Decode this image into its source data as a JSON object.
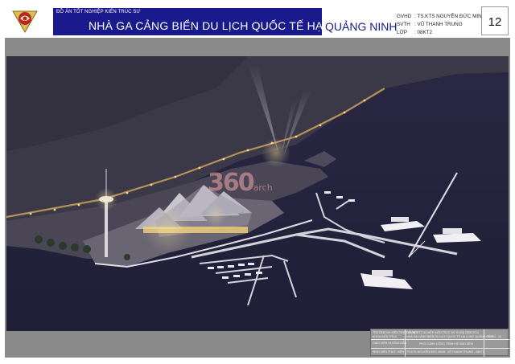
{
  "header": {
    "school_label": "ĐỒ ÁN TỐT NGHIỆP KIẾN TRÚC SƯ",
    "title": "NHÀ GA CẢNG BIỂN DU LỊCH QUỐC TẾ  HẠ LONG",
    "title_suffix": "QUẢNG NINH",
    "info": [
      {
        "key": "GVHD",
        "value": ": TS.KTS NGUYỄN ĐỨC MINH"
      },
      {
        "key": "SVTH",
        "value": ": VŨ THANH TRUNG"
      },
      {
        "key": "LỚP",
        "value": ": 08KT2"
      }
    ],
    "page_number": "12"
  },
  "watermark": {
    "number": "360",
    "suffix": "arch"
  },
  "title_block": {
    "project_line1": "ĐỒ ÁN TỐT NGHIỆP KIẾN TRÚC SƯ KHÓA 2008-2013",
    "project_line2": "NHÀ GA CẢNG BIỂN DU LỊCH QUỐC TẾ HẠ LONG QUẢNG NINH",
    "drawing_name": "PHỐI CẢNH CÔNG TRÌNH VỀ BAN ĐÊM",
    "label_school": "TRƯỜNG ĐH KIẾN TRÚC HÀ NỘI",
    "label_faculty": "KHOA KIẾN TRÚC",
    "label_advisor": "GIÁO VIÊN HƯỚNG DẪN",
    "label_student": "SINH VIÊN THỰC HIỆN",
    "advisor": "TS.KTS NGUYỄN ĐỨC MINH",
    "student": "VŨ THANH TRUNG - 08KT2",
    "sheet_label": "TỜ SỐ",
    "sheet_no": "12"
  },
  "colors": {
    "header_blue": "#1a1a8c",
    "mat_gray": "#8a8a8a",
    "water": "#2c2a4a",
    "land": "#3d3a4e"
  }
}
